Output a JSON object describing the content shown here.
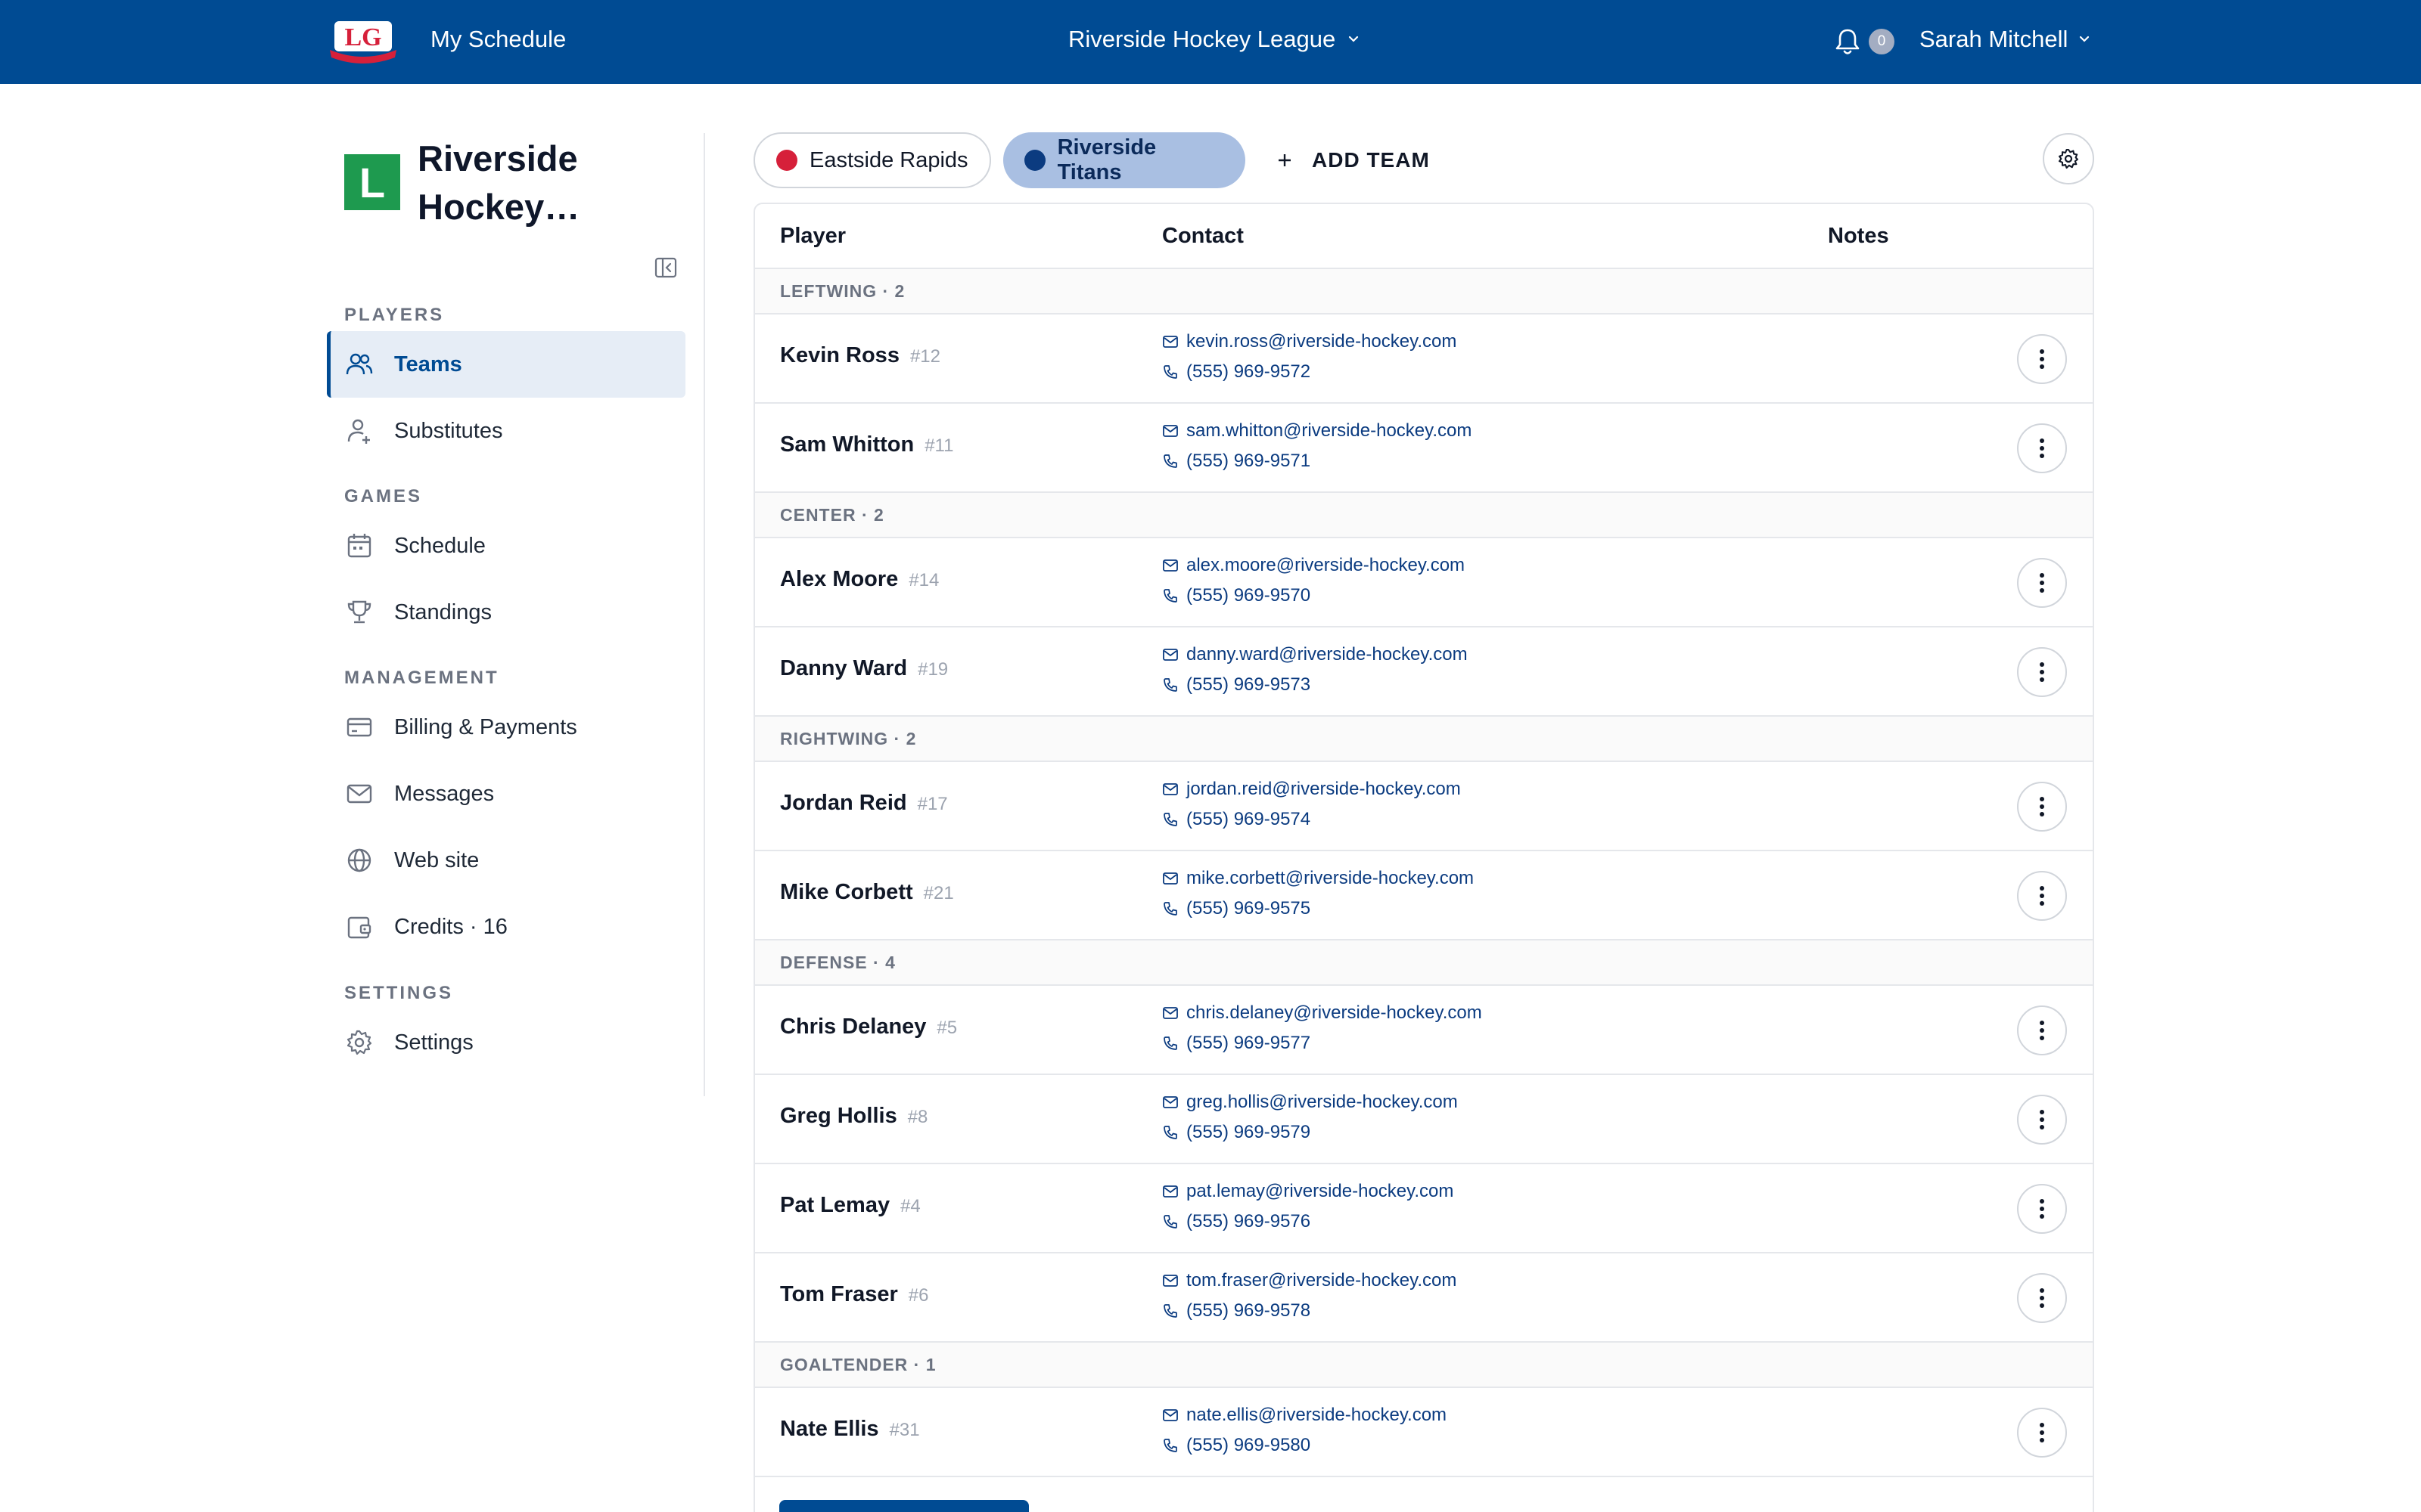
{
  "header": {
    "my_schedule": "My Schedule",
    "league": "Riverside Hockey League",
    "notification_count": "0",
    "user": "Sarah Mitchell",
    "logo_text": "LG"
  },
  "sidebar": {
    "org_initial": "L",
    "org_name": "Riverside Hockey…",
    "sections": {
      "players": "PLAYERS",
      "games": "GAMES",
      "management": "MANAGEMENT",
      "settings": "SETTINGS"
    },
    "items": [
      {
        "label": "Teams",
        "icon": "users-icon",
        "active": true
      },
      {
        "label": "Substitutes",
        "icon": "user-plus-icon"
      },
      {
        "label": "Schedule",
        "icon": "calendar-icon"
      },
      {
        "label": "Standings",
        "icon": "trophy-icon"
      },
      {
        "label": "Billing & Payments",
        "icon": "credit-card-icon"
      },
      {
        "label": "Messages",
        "icon": "mail-icon"
      },
      {
        "label": "Web site",
        "icon": "globe-icon"
      },
      {
        "label": "Credits · 16",
        "icon": "wallet-icon"
      },
      {
        "label": "Settings",
        "icon": "gear-icon"
      }
    ]
  },
  "teams": {
    "tabs": [
      {
        "label": "Eastside Rapids",
        "color": "#d6203a",
        "selected": false
      },
      {
        "label": "Riverside Titans",
        "color": "#0b3b80",
        "selected": true
      }
    ],
    "add_team": "ADD TEAM"
  },
  "table": {
    "columns": {
      "player": "Player",
      "contact": "Contact",
      "notes": "Notes"
    },
    "groups": [
      {
        "label": "LEFTWING · 2",
        "players": [
          {
            "name": "Kevin Ross",
            "number": "#12",
            "email": "kevin.ross@riverside-hockey.com",
            "phone": "(555) 969-9572"
          },
          {
            "name": "Sam Whitton",
            "number": "#11",
            "email": "sam.whitton@riverside-hockey.com",
            "phone": "(555) 969-9571"
          }
        ]
      },
      {
        "label": "CENTER · 2",
        "players": [
          {
            "name": "Alex Moore",
            "number": "#14",
            "email": "alex.moore@riverside-hockey.com",
            "phone": "(555) 969-9570"
          },
          {
            "name": "Danny Ward",
            "number": "#19",
            "email": "danny.ward@riverside-hockey.com",
            "phone": "(555) 969-9573"
          }
        ]
      },
      {
        "label": "RIGHTWING · 2",
        "players": [
          {
            "name": "Jordan Reid",
            "number": "#17",
            "email": "jordan.reid@riverside-hockey.com",
            "phone": "(555) 969-9574"
          },
          {
            "name": "Mike Corbett",
            "number": "#21",
            "email": "mike.corbett@riverside-hockey.com",
            "phone": "(555) 969-9575"
          }
        ]
      },
      {
        "label": "DEFENSE · 4",
        "players": [
          {
            "name": "Chris Delaney",
            "number": "#5",
            "email": "chris.delaney@riverside-hockey.com",
            "phone": "(555) 969-9577"
          },
          {
            "name": "Greg Hollis",
            "number": "#8",
            "email": "greg.hollis@riverside-hockey.com",
            "phone": "(555) 969-9579"
          },
          {
            "name": "Pat Lemay",
            "number": "#4",
            "email": "pat.lemay@riverside-hockey.com",
            "phone": "(555) 969-9576"
          },
          {
            "name": "Tom Fraser",
            "number": "#6",
            "email": "tom.fraser@riverside-hockey.com",
            "phone": "(555) 969-9578"
          }
        ]
      },
      {
        "label": "GOALTENDER · 1",
        "players": [
          {
            "name": "Nate Ellis",
            "number": "#31",
            "email": "nate.ellis@riverside-hockey.com",
            "phone": "(555) 969-9580"
          }
        ]
      }
    ]
  }
}
